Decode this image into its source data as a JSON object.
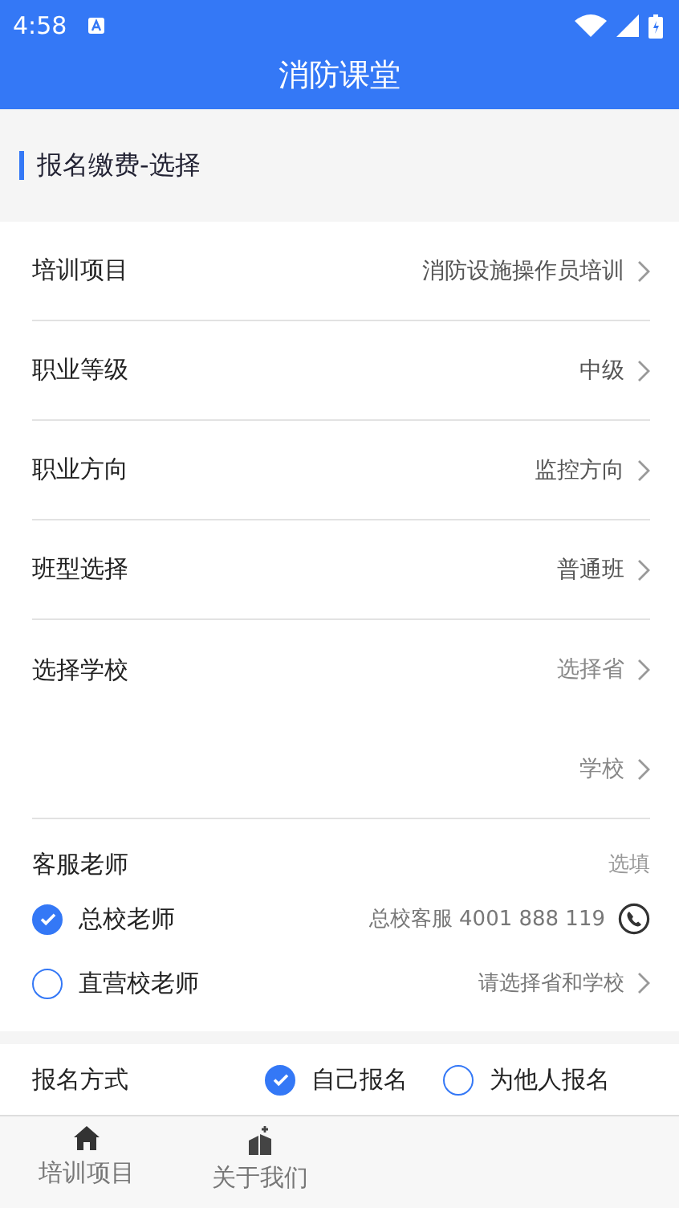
{
  "status_bar": {
    "time": "4:58"
  },
  "title": "消防课堂",
  "section_title": "报名缴费-选择",
  "rows": [
    {
      "label": "培训项目",
      "value": "消防设施操作员培训",
      "placeholder": false,
      "divider": true
    },
    {
      "label": "职业等级",
      "value": "中级",
      "placeholder": false,
      "divider": true
    },
    {
      "label": "职业方向",
      "value": "监控方向",
      "placeholder": false,
      "divider": true
    },
    {
      "label": "班型选择",
      "value": "普通班",
      "placeholder": false,
      "divider": true
    },
    {
      "label": "选择学校",
      "value": "选择省",
      "placeholder": true,
      "divider": false
    },
    {
      "value": "学校",
      "placeholder": true,
      "divider": true
    }
  ],
  "teacher": {
    "label": "客服老师",
    "note": "选填",
    "options": [
      {
        "label": "总校老师",
        "selected": true,
        "detail": "总校客服 4001 888 119",
        "kind": "phone"
      },
      {
        "label": "直营校老师",
        "selected": false,
        "detail": "请选择省和学校",
        "kind": "link"
      }
    ]
  },
  "signup": {
    "label": "报名方式",
    "options": [
      {
        "label": "自己报名",
        "selected": true
      },
      {
        "label": "为他人报名",
        "selected": false
      }
    ]
  },
  "tabs": [
    {
      "label": "培训项目"
    },
    {
      "label": "关于我们"
    }
  ]
}
